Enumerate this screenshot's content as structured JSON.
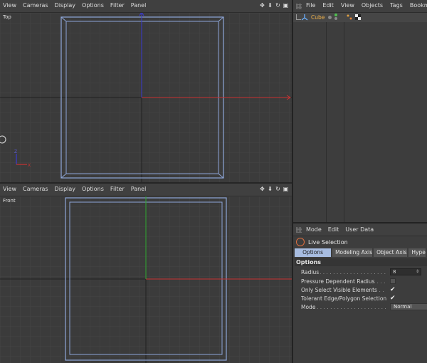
{
  "viewport_top": {
    "menu": [
      "View",
      "Cameras",
      "Display",
      "Options",
      "Filter",
      "Panel"
    ],
    "label": "Top",
    "nav_icons": [
      "move-icon",
      "zoom-icon",
      "rotate-icon",
      "maximize-icon"
    ]
  },
  "viewport_front": {
    "menu": [
      "View",
      "Cameras",
      "Display",
      "Options",
      "Filter",
      "Panel"
    ],
    "label": "Front",
    "nav_icons": [
      "move-icon",
      "zoom-icon",
      "rotate-icon",
      "maximize-icon"
    ]
  },
  "object_manager": {
    "menu": [
      "File",
      "Edit",
      "View",
      "Objects",
      "Tags",
      "Bookmarks"
    ],
    "objects": [
      {
        "name": "Cube",
        "icon": "cube-icon",
        "name_color": "#f0b24a"
      }
    ]
  },
  "attribute_manager": {
    "menu": [
      "Mode",
      "Edit",
      "User Data"
    ],
    "tool_name": "Live Selection",
    "tabs": [
      "Options",
      "Modeling Axis",
      "Object Axis",
      "Hype"
    ],
    "active_tab": "Options",
    "section_title": "Options",
    "params": {
      "radius_label": "Radius",
      "radius_value": "8",
      "pressure_label": "Pressure Dependent Radius",
      "pressure_checked": false,
      "visible_label": "Only Select Visible Elements",
      "visible_checked": true,
      "tolerant_label": "Tolerant Edge/Polygon Selection",
      "tolerant_checked": true,
      "mode_label": "Mode",
      "mode_value": "Normal"
    }
  },
  "colors": {
    "viewport_bg": "#3b3b3b",
    "panel_bg": "#3d3d3d",
    "axis_x": "#c83232",
    "axis_y": "#2fa82f",
    "axis_z": "#3a3ad0",
    "object_outline": "#8ea6d8",
    "active_tab": "#a7bce0",
    "tool_icon": "#e07040"
  }
}
